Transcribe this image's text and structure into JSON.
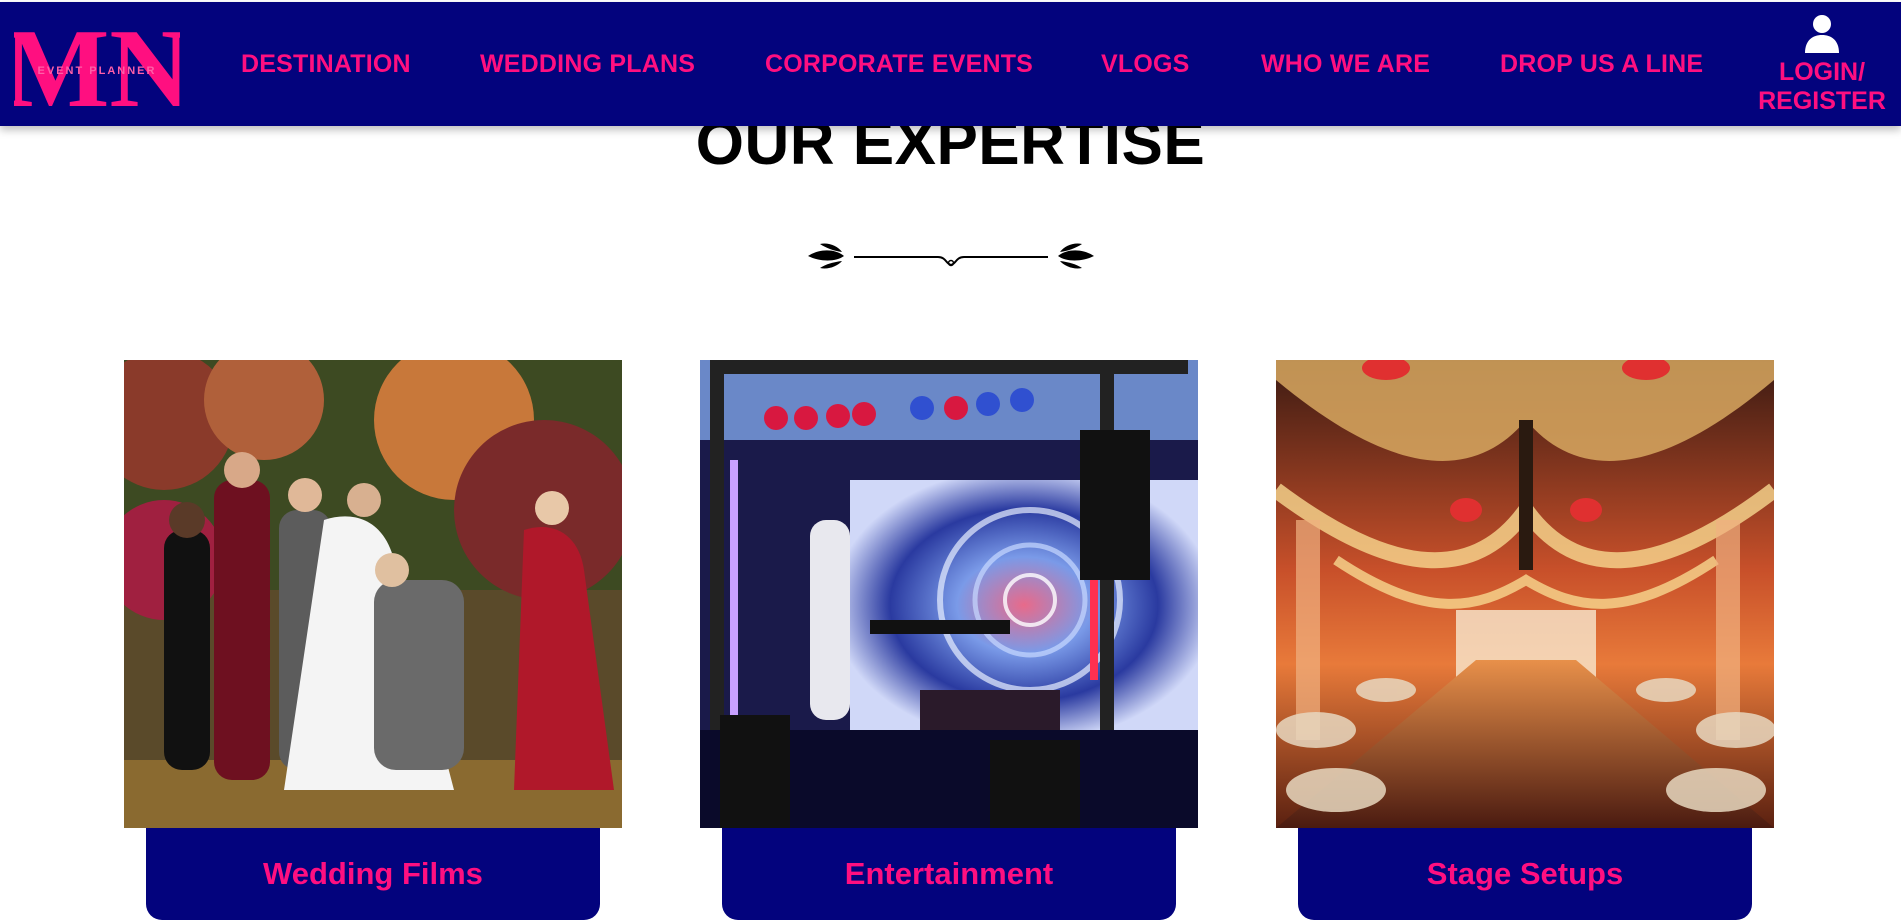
{
  "brand": {
    "logo_letters": "MN",
    "logo_tagline": "EVENT PLANNER"
  },
  "nav": {
    "items": [
      "DESTINATION",
      "WEDDING PLANS",
      "CORPORATE EVENTS",
      "VLOGS",
      "WHO WE ARE",
      "DROP US A LINE"
    ],
    "login_line1": "LOGIN/",
    "login_line2": "REGISTER"
  },
  "section": {
    "title": "OUR EXPERTISE"
  },
  "cards": [
    {
      "label": "Wedding Films",
      "image": "wedding-party-photo"
    },
    {
      "label": "Entertainment",
      "image": "dj-stage-photo"
    },
    {
      "label": "Stage Setups",
      "image": "banquet-hall-photo"
    }
  ],
  "colors": {
    "navy": "#03037d",
    "pink": "#ff0f80",
    "text": "#000000",
    "background": "#ffffff"
  }
}
